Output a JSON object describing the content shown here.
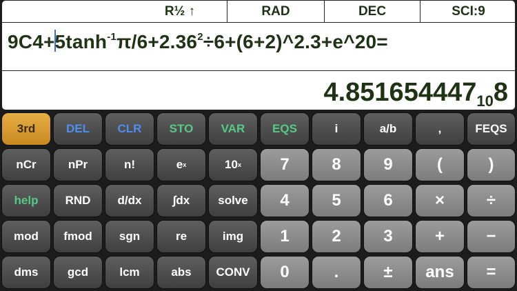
{
  "status": {
    "mode": "R½ ↑",
    "angle": "RAD",
    "base": "DEC",
    "format": "SCI:9"
  },
  "display": {
    "expression_before_cursor": "9C4+",
    "expression_after_cursor": "5tanh",
    "expression_sup1": "-1",
    "expression_mid": "π/6+2.36",
    "expression_sup2": "2",
    "expression_end": "÷6+(6+2)^2.3+e^20=",
    "result_mantissa": "4.851654447",
    "result_base": "10",
    "result_exponent": "8"
  },
  "keys": {
    "row1": [
      "3rd",
      "DEL",
      "CLR",
      "STO",
      "VAR",
      "EQS",
      "i",
      "a/b",
      ",",
      "FEQS"
    ],
    "row2": [
      "nCr",
      "nPr",
      "n!",
      "e",
      "10",
      "7",
      "8",
      "9",
      "(",
      ")"
    ],
    "row2_sup": [
      "x",
      "x"
    ],
    "row3": [
      "help",
      "RND",
      "d/dx",
      "∫dx",
      "solve",
      "4",
      "5",
      "6",
      "×",
      "÷"
    ],
    "row4": [
      "mod",
      "fmod",
      "sgn",
      "re",
      "img",
      "1",
      "2",
      "3",
      "+",
      "−"
    ],
    "row5": [
      "dms",
      "gcd",
      "lcm",
      "abs",
      "CONV",
      "0",
      ".",
      "±",
      "ans",
      "="
    ]
  },
  "colors": {
    "accent_orange": "#e0a43a",
    "label_blue": "#4d8ef0",
    "label_green": "#56c987",
    "display_text": "#1e3314"
  }
}
